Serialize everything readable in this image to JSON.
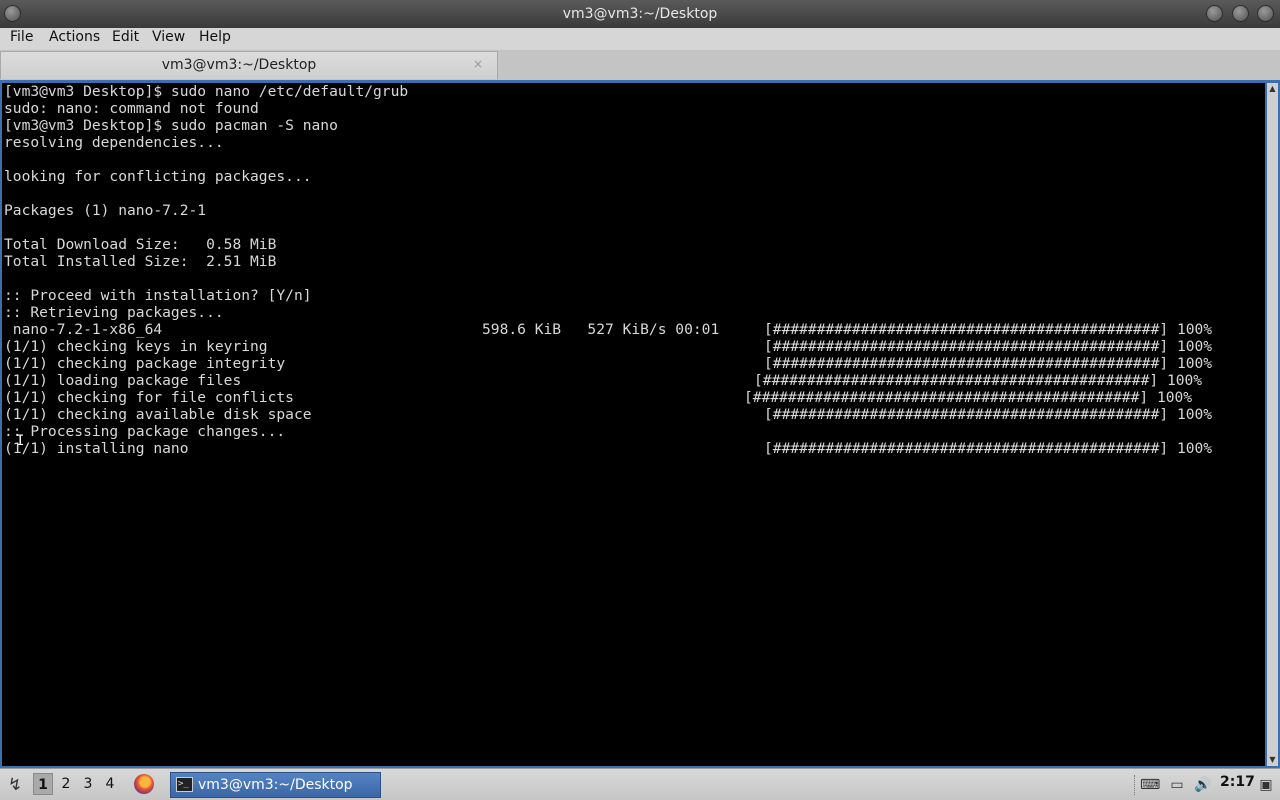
{
  "window": {
    "title": "vm3@vm3:~/Desktop"
  },
  "menu": {
    "file": "File",
    "actions": "Actions",
    "edit": "Edit",
    "view": "View",
    "help": "Help"
  },
  "tab": {
    "label": "vm3@vm3:~/Desktop",
    "close": "×"
  },
  "terminal": {
    "lines": [
      "[vm3@vm3 Desktop]$ sudo nano /etc/default/grub",
      "sudo: nano: command not found",
      "[vm3@vm3 Desktop]$ sudo pacman -S nano",
      "resolving dependencies...",
      "",
      "looking for conflicting packages...",
      "",
      "Packages (1) nano-7.2-1",
      "",
      "Total Download Size:   0.58 MiB",
      "Total Installed Size:  2.51 MiB",
      "",
      ":: Proceed with installation? [Y/n]",
      ":: Retrieving packages...",
      " nano-7.2-1-x86_64",
      "(1/1) checking keys in keyring",
      "(1/1) checking package integrity",
      "(1/1) loading package files",
      "(1/1) checking for file conflicts",
      "(1/1) checking available disk space",
      ":: Processing package changes...",
      "(1/1) installing nano"
    ],
    "download_stats": "598.6 KiB   527 KiB/s 00:01",
    "progress": {
      "full": "[############################################] 100%"
    }
  },
  "taskbar": {
    "desktops": [
      "1",
      "2",
      "3",
      "4"
    ],
    "task_label": "vm3@vm3:~/Desktop",
    "clock": "2:17"
  },
  "icons": {
    "start": "start-menu-icon",
    "firefox": "firefox-icon",
    "terminal": "terminal-icon",
    "keyboard": "keyboard-layout-icon",
    "drive": "drive-icon",
    "volume": "volume-icon",
    "desktop": "show-desktop-icon"
  }
}
